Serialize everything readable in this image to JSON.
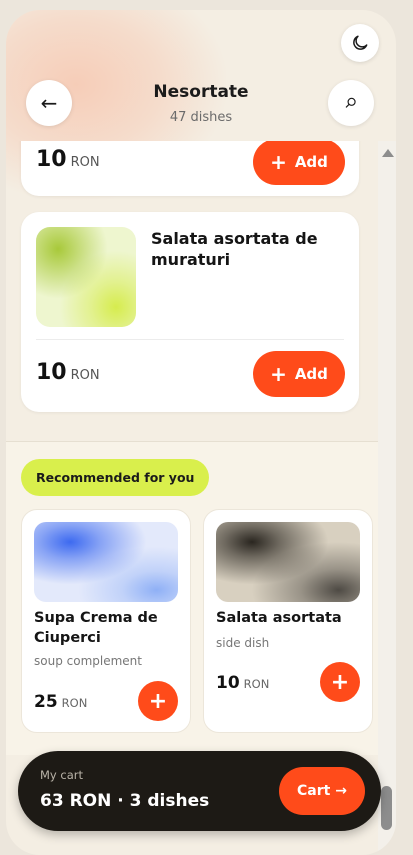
{
  "header": {
    "title": "Nesortate",
    "subtitle": "47 dishes",
    "back_icon": "arrow-left-icon",
    "search_icon": "search-icon",
    "theme_icon": "moon-icon"
  },
  "dishes": [
    {
      "name": "",
      "price": "10",
      "currency": "RON",
      "add_label": "Add"
    },
    {
      "name": "Salata asortata de muraturi",
      "price": "10",
      "currency": "RON",
      "add_label": "Add"
    }
  ],
  "recommended": {
    "heading": "Recommended for you",
    "items": [
      {
        "name": "Supa Crema de Ciuperci",
        "category": "soup complement",
        "price": "25",
        "currency": "RON"
      },
      {
        "name": "Salata asortata",
        "category": "side dish",
        "price": "10",
        "currency": "RON"
      }
    ]
  },
  "cart": {
    "label": "My cart",
    "summary": "63 RON · 3 dishes",
    "button_label": "Cart →"
  },
  "colors": {
    "accent": "#ff4b1a",
    "highlight": "#d9ef4c",
    "dark": "#1d1a15",
    "background": "#f4eee3"
  }
}
